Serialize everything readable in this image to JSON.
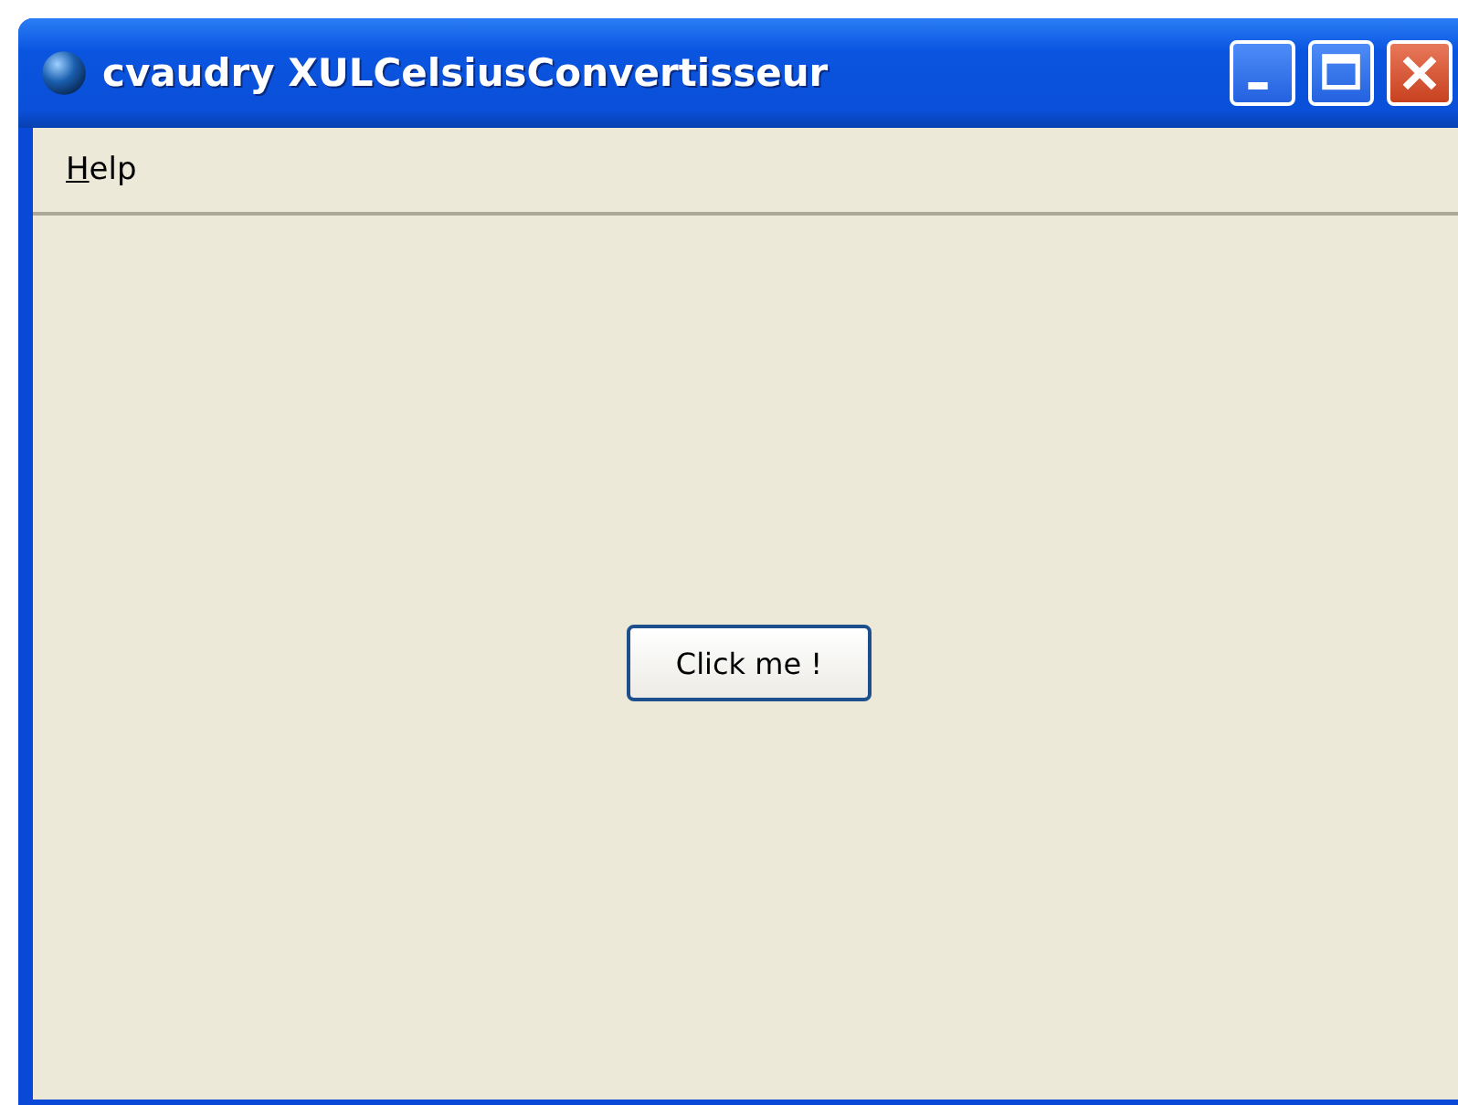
{
  "window": {
    "title": "cvaudry XULCelsiusConvertisseur"
  },
  "menu_bar": [
    {
      "mnemonic": "H",
      "rest": "elp"
    }
  ],
  "button": {
    "label": "Click me !"
  }
}
